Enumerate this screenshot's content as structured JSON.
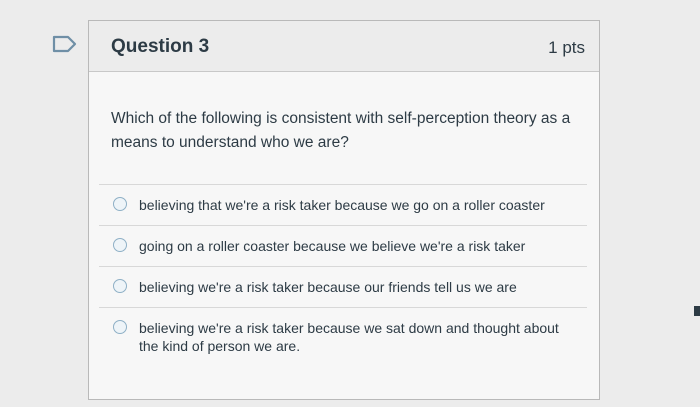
{
  "question": {
    "title": "Question 3",
    "points": "1 pts",
    "text": "Which of the following is consistent with self-perception theory as a means to understand who we are?",
    "answers": [
      {
        "label": "believing that we're a risk taker because we go on a roller coaster"
      },
      {
        "label": "going on a roller coaster because we believe we're a risk taker"
      },
      {
        "label": "believing we're a risk taker because our friends tell us we are"
      },
      {
        "label": "believing we're a risk taker because we sat down and thought about the kind of person we are."
      }
    ]
  },
  "icons": {
    "flag": "flag-icon",
    "radio": "radio-button-icon"
  },
  "colors": {
    "text": "#2d3b45",
    "radio_border": "#8fb0c6",
    "flag": "#6f8fa6"
  }
}
